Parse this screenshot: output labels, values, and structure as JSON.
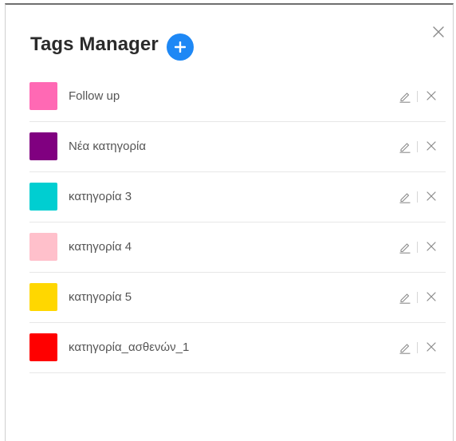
{
  "dialog": {
    "title": "Tags Manager",
    "add_icon": "plus-icon",
    "close_icon": "close-icon"
  },
  "colors": {
    "accent": "#1e88f5",
    "title": "#2b2b2b",
    "text": "#555555",
    "icon": "#8a8a8a"
  },
  "tags": [
    {
      "name": "Follow up",
      "color": "#ff69b4"
    },
    {
      "name": "Νέα κατηγορία",
      "color": "#800080"
    },
    {
      "name": "κατηγορία 3",
      "color": "#00ced1"
    },
    {
      "name": "κατηγορία 4",
      "color": "#ffc0cb"
    },
    {
      "name": "κατηγορία 5",
      "color": "#ffd700"
    },
    {
      "name": "κατηγορία_ασθενών_1",
      "color": "#ff0000"
    }
  ],
  "row_actions": {
    "edit_icon": "pencil-icon",
    "delete_icon": "close-icon"
  }
}
